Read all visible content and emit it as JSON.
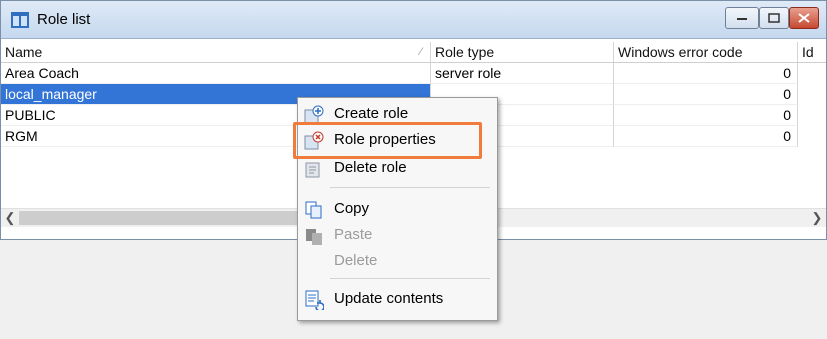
{
  "window": {
    "title": "Role list"
  },
  "columns": [
    "Name",
    "Role type",
    "Windows error code",
    "Id"
  ],
  "rows": [
    {
      "name": "Area Coach",
      "role_type": "server role",
      "error_code": "0",
      "selected": false
    },
    {
      "name": "local_manager",
      "role_type": "",
      "error_code": "0",
      "selected": true
    },
    {
      "name": "PUBLIC",
      "role_type": "",
      "error_code": "0",
      "selected": false
    },
    {
      "name": "RGM",
      "role_type": "",
      "error_code": "0",
      "selected": false
    }
  ],
  "context_menu": {
    "items": [
      {
        "label": "Create role",
        "icon": "create-role-icon",
        "disabled": false
      },
      {
        "label": "Role properties",
        "icon": "role-properties-icon",
        "disabled": false
      },
      {
        "label": "Delete role",
        "icon": "delete-role-icon",
        "disabled": false
      },
      {
        "label": "Copy",
        "icon": "copy-icon",
        "disabled": false
      },
      {
        "label": "Paste",
        "icon": "paste-icon",
        "disabled": true
      },
      {
        "label": "Delete",
        "icon": "",
        "disabled": true
      },
      {
        "label": "Update contents",
        "icon": "update-contents-icon",
        "disabled": false
      }
    ]
  },
  "colors": {
    "selection": "#3375d6",
    "highlight_border": "#f07b3c"
  }
}
